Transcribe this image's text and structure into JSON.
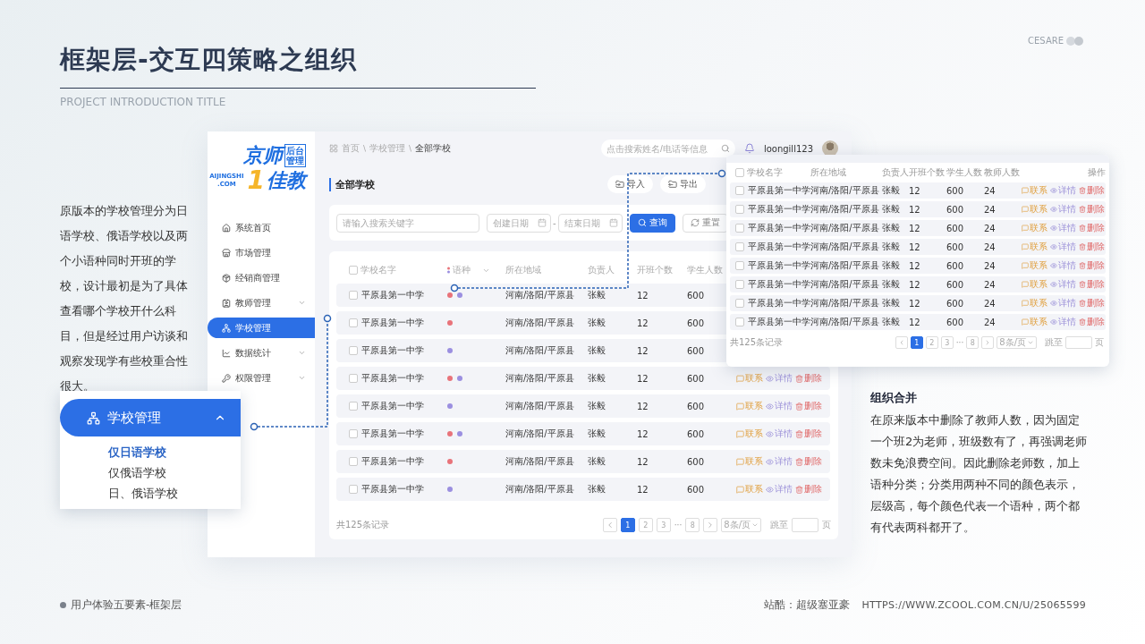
{
  "slide": {
    "title": "框架层-交互四策略之组织",
    "subtitle": "PROJECT INTRODUCTION TITLE",
    "brand": "CESARE",
    "intro": "原版本的学校管理分为日语学校、俄语学校以及两个小语种同时开班的学校，设计最初是为了具体查看哪个学校开什么科目，但是经过用户访谈和观察发现学有些校重合性很大。",
    "callout": {
      "label": "学校管理",
      "expanded": true,
      "options": [
        {
          "label": "仅日语学校",
          "selected": true
        },
        {
          "label": "仅俄语学校",
          "selected": false
        },
        {
          "label": "日、俄语学校",
          "selected": false
        }
      ]
    },
    "note": {
      "title": "组织合并",
      "body": "在原来版本中删除了教师人数，因为固定一个班2为老师，班级数有了，再强调老师数未免浪费空间。因此删除老师数，加上语种分类；分类用两种不同的颜色表示，层级高，每个颜色代表一个语种，两个都有代表两科都开了。"
    },
    "footer": {
      "caption": "用户体验五要素-框架层",
      "credit": "站酷：超级塞亚豪",
      "url": "HTTPS://WWW.ZCOOL.COM.CN/U/25065599"
    }
  },
  "app": {
    "logo": {
      "top": "京师",
      "badge": "后台管理",
      "domain": "AIJINGSHI",
      "tld": ".COM",
      "digit": "1",
      "bottom": "佳教"
    },
    "nav": [
      {
        "label": "系统首页",
        "has_submenu": false,
        "selected": false
      },
      {
        "label": "市场管理",
        "has_submenu": false,
        "selected": false
      },
      {
        "label": "经销商管理",
        "has_submenu": false,
        "selected": false
      },
      {
        "label": "教师管理",
        "has_submenu": true,
        "selected": false
      },
      {
        "label": "学校管理",
        "has_submenu": false,
        "selected": true
      },
      {
        "label": "数据统计",
        "has_submenu": true,
        "selected": false
      },
      {
        "label": "权限管理",
        "has_submenu": true,
        "selected": false
      }
    ],
    "breadcrumb": [
      "首页",
      "学校管理",
      "全部学校"
    ],
    "breadcrumb_separator": "\\",
    "search_placeholder": "点击搜索姓名/电话等信息",
    "user": "loongill123",
    "page_title": "全部学校",
    "tools": [
      "导入",
      "导出"
    ],
    "filter": {
      "keyword_placeholder": "请输入搜索关键字",
      "start_placeholder": "创建日期",
      "range_separator": "-",
      "end_placeholder": "结束日期",
      "search": "查询",
      "reset": "重置"
    },
    "table": {
      "header_checked": false,
      "columns": [
        "学校名字",
        "语种",
        "所在地域",
        "负责人",
        "开班个数",
        "学生人数"
      ],
      "rows": [
        {
          "checked": false,
          "name": "平原县第一中学",
          "languages": [
            {
              "color": "#e8737a"
            },
            {
              "color": "#9b8fe0"
            }
          ],
          "region": "河南/洛阳/平原县",
          "person": "张毅",
          "classes": "12",
          "students": "600"
        },
        {
          "checked": false,
          "name": "平原县第一中学",
          "languages": [
            {
              "color": "#e8737a"
            }
          ],
          "region": "河南/洛阳/平原县",
          "person": "张毅",
          "classes": "12",
          "students": "600"
        },
        {
          "checked": false,
          "name": "平原县第一中学",
          "languages": [
            {
              "color": "#9b8fe0"
            }
          ],
          "region": "河南/洛阳/平原县",
          "person": "张毅",
          "classes": "12",
          "students": "600"
        },
        {
          "checked": false,
          "name": "平原县第一中学",
          "languages": [
            {
              "color": "#e8737a"
            },
            {
              "color": "#9b8fe0"
            }
          ],
          "region": "河南/洛阳/平原县",
          "person": "张毅",
          "classes": "12",
          "students": "600",
          "actions": [
            {
              "kind": "contact",
              "label": "联系"
            },
            {
              "kind": "detail",
              "label": "详情"
            },
            {
              "kind": "delete",
              "label": "删除"
            }
          ]
        },
        {
          "checked": false,
          "name": "平原县第一中学",
          "languages": [
            {
              "color": "#9b8fe0"
            }
          ],
          "region": "河南/洛阳/平原县",
          "person": "张毅",
          "classes": "12",
          "students": "600",
          "actions": [
            {
              "kind": "contact",
              "label": "联系"
            },
            {
              "kind": "detail",
              "label": "详情"
            },
            {
              "kind": "delete",
              "label": "删除"
            }
          ]
        },
        {
          "checked": false,
          "name": "平原县第一中学",
          "languages": [
            {
              "color": "#e8737a"
            },
            {
              "color": "#9b8fe0"
            }
          ],
          "region": "河南/洛阳/平原县",
          "person": "张毅",
          "classes": "12",
          "students": "600",
          "actions": [
            {
              "kind": "contact",
              "label": "联系"
            },
            {
              "kind": "detail",
              "label": "详情"
            },
            {
              "kind": "delete",
              "label": "删除"
            }
          ]
        },
        {
          "checked": false,
          "name": "平原县第一中学",
          "languages": [
            {
              "color": "#e8737a"
            }
          ],
          "region": "河南/洛阳/平原县",
          "person": "张毅",
          "classes": "12",
          "students": "600",
          "actions": [
            {
              "kind": "contact",
              "label": "联系"
            },
            {
              "kind": "detail",
              "label": "详情"
            },
            {
              "kind": "delete",
              "label": "删除"
            }
          ]
        },
        {
          "checked": false,
          "name": "平原县第一中学",
          "languages": [
            {
              "color": "#9b8fe0"
            }
          ],
          "region": "河南/洛阳/平原县",
          "person": "张毅",
          "classes": "12",
          "students": "600",
          "actions": [
            {
              "kind": "contact",
              "label": "联系"
            },
            {
              "kind": "detail",
              "label": "详情"
            },
            {
              "kind": "delete",
              "label": "删除"
            }
          ]
        }
      ],
      "total": "共125条记录",
      "pagination": {
        "pages": [
          {
            "label": "1",
            "selected": true
          },
          {
            "label": "2",
            "selected": false
          },
          {
            "label": "3",
            "selected": false
          },
          {
            "label": "8",
            "selected": false
          }
        ],
        "ellipsis": "···",
        "page_size": "8条/页",
        "jump_label": "跳至",
        "page_unit": "页"
      }
    }
  },
  "popup": {
    "header_checked": false,
    "columns": [
      "学校名字",
      "所在地域",
      "负责人",
      "开班个数",
      "学生人数",
      "教师人数",
      "操作"
    ],
    "rows": [
      {
        "checked": false,
        "name": "平原县第一中学",
        "region": "河南/洛阳/平原县",
        "person": "张毅",
        "classes": "12",
        "students": "600",
        "teachers": "24",
        "actions": [
          {
            "kind": "contact",
            "label": "联系"
          },
          {
            "kind": "detail",
            "label": "详情"
          },
          {
            "kind": "delete",
            "label": "删除"
          }
        ]
      },
      {
        "checked": false,
        "name": "平原县第一中学",
        "region": "河南/洛阳/平原县",
        "person": "张毅",
        "classes": "12",
        "students": "600",
        "teachers": "24",
        "actions": [
          {
            "kind": "contact",
            "label": "联系"
          },
          {
            "kind": "detail",
            "label": "详情"
          },
          {
            "kind": "delete",
            "label": "删除"
          }
        ]
      },
      {
        "checked": false,
        "name": "平原县第一中学",
        "region": "河南/洛阳/平原县",
        "person": "张毅",
        "classes": "12",
        "students": "600",
        "teachers": "24",
        "actions": [
          {
            "kind": "contact",
            "label": "联系"
          },
          {
            "kind": "detail",
            "label": "详情"
          },
          {
            "kind": "delete",
            "label": "删除"
          }
        ]
      },
      {
        "checked": false,
        "name": "平原县第一中学",
        "region": "河南/洛阳/平原县",
        "person": "张毅",
        "classes": "12",
        "students": "600",
        "teachers": "24",
        "actions": [
          {
            "kind": "contact",
            "label": "联系"
          },
          {
            "kind": "detail",
            "label": "详情"
          },
          {
            "kind": "delete",
            "label": "删除"
          }
        ]
      },
      {
        "checked": false,
        "name": "平原县第一中学",
        "region": "河南/洛阳/平原县",
        "person": "张毅",
        "classes": "12",
        "students": "600",
        "teachers": "24",
        "actions": [
          {
            "kind": "contact",
            "label": "联系"
          },
          {
            "kind": "detail",
            "label": "详情"
          },
          {
            "kind": "delete",
            "label": "删除"
          }
        ]
      },
      {
        "checked": false,
        "name": "平原县第一中学",
        "region": "河南/洛阳/平原县",
        "person": "张毅",
        "classes": "12",
        "students": "600",
        "teachers": "24",
        "actions": [
          {
            "kind": "contact",
            "label": "联系"
          },
          {
            "kind": "detail",
            "label": "详情"
          },
          {
            "kind": "delete",
            "label": "删除"
          }
        ]
      },
      {
        "checked": false,
        "name": "平原县第一中学",
        "region": "河南/洛阳/平原县",
        "person": "张毅",
        "classes": "12",
        "students": "600",
        "teachers": "24",
        "actions": [
          {
            "kind": "contact",
            "label": "联系"
          },
          {
            "kind": "detail",
            "label": "详情"
          },
          {
            "kind": "delete",
            "label": "删除"
          }
        ]
      },
      {
        "checked": false,
        "name": "平原县第一中学",
        "region": "河南/洛阳/平原县",
        "person": "张毅",
        "classes": "12",
        "students": "600",
        "teachers": "24",
        "actions": [
          {
            "kind": "contact",
            "label": "联系"
          },
          {
            "kind": "detail",
            "label": "详情"
          },
          {
            "kind": "delete",
            "label": "删除"
          }
        ]
      }
    ],
    "total": "共125条记录",
    "pagination": {
      "pages": [
        {
          "label": "1",
          "selected": true
        },
        {
          "label": "2",
          "selected": false
        },
        {
          "label": "3",
          "selected": false
        },
        {
          "label": "8",
          "selected": false
        }
      ],
      "ellipsis": "···",
      "page_size": "8条/页",
      "jump_label": "跳至",
      "page_unit": "页"
    }
  }
}
